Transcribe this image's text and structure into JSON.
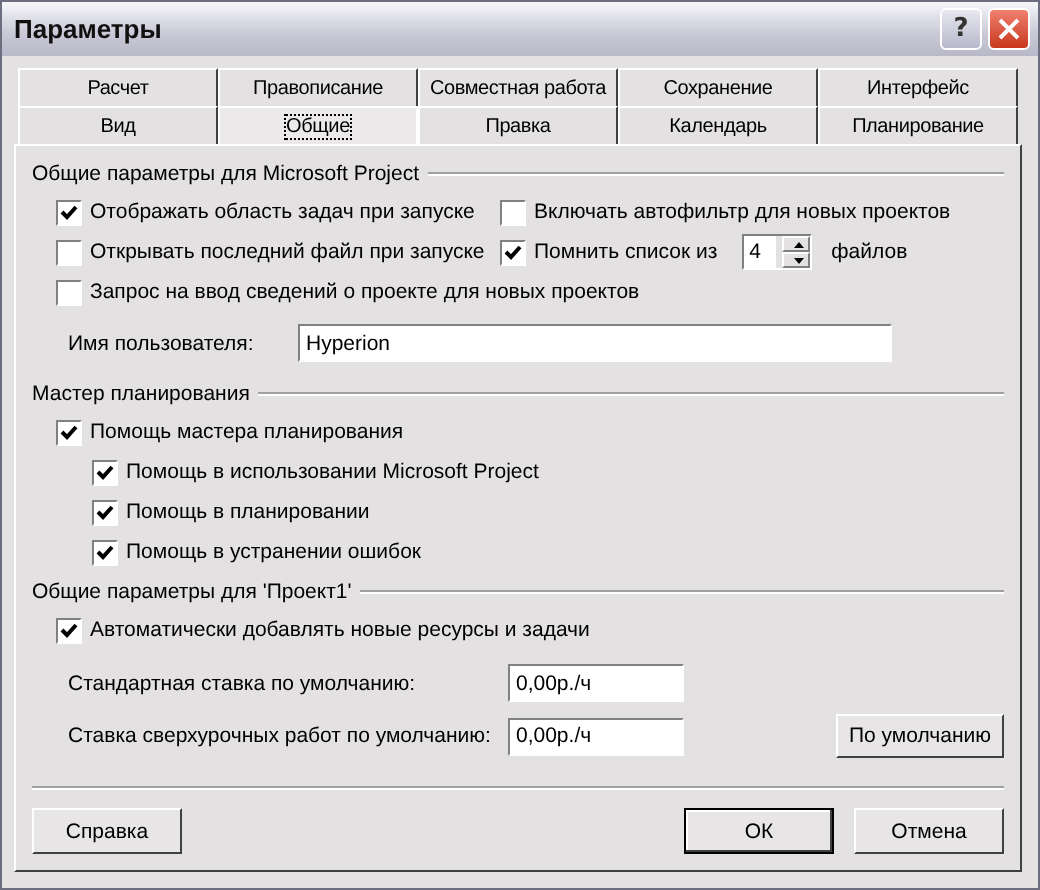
{
  "window": {
    "title": "Параметры",
    "help_button": "?"
  },
  "tabs": [
    [
      {
        "label": "Расчет",
        "selected": false
      },
      {
        "label": "Правописание",
        "selected": false
      },
      {
        "label": "Совместная работа",
        "selected": false
      },
      {
        "label": "Сохранение",
        "selected": false
      },
      {
        "label": "Интерфейс",
        "selected": false
      }
    ],
    [
      {
        "label": "Вид",
        "selected": false
      },
      {
        "label": "Общие",
        "selected": true
      },
      {
        "label": "Правка",
        "selected": false
      },
      {
        "label": "Календарь",
        "selected": false
      },
      {
        "label": "Планирование",
        "selected": false
      }
    ]
  ],
  "general": {
    "title": "Общие параметры для Microsoft Project",
    "options": [
      {
        "kind": "checkbox",
        "label": "Отображать область задач при запуске",
        "checked": true
      },
      {
        "kind": "checkbox",
        "label": "Включать автофильтр для новых проектов",
        "checked": false
      },
      {
        "kind": "checkbox",
        "label": "Открывать последний файл при запуске",
        "checked": false
      },
      {
        "kind": "spin",
        "label": "Помнить список из",
        "checked": true,
        "value": "4",
        "suffix": "файлов"
      },
      {
        "kind": "wide",
        "label": "Запрос на ввод сведений о проекте для новых проектов",
        "checked": false
      }
    ],
    "user_name": {
      "label": "Имя пользователя:",
      "value": "Hyperion"
    }
  },
  "wizard": {
    "title": "Мастер планирования",
    "label": "Помощь мастера планирования",
    "checked": true,
    "children": [
      {
        "label": "Помощь в использовании Microsoft Project",
        "checked": true
      },
      {
        "label": "Помощь в планировании",
        "checked": true
      },
      {
        "label": "Помощь в устранении ошибок",
        "checked": true
      }
    ]
  },
  "project": {
    "title": "Общие параметры для 'Проект1'",
    "auto_add": {
      "label": "Автоматически добавлять новые ресурсы и задачи",
      "checked": true
    },
    "rates": [
      {
        "label": "Стандартная ставка по умолчанию:",
        "value": "0,00р./ч"
      },
      {
        "label": "Ставка сверхурочных работ по умолчанию:",
        "value": "0,00р./ч"
      }
    ],
    "default_button": "По умолчанию"
  },
  "buttons": {
    "help": "Справка",
    "ok": "ОК",
    "cancel": "Отмена"
  }
}
